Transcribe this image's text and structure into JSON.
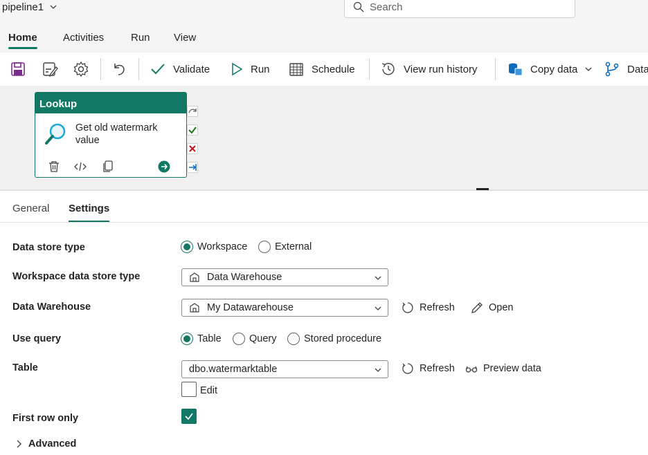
{
  "header": {
    "pipeline_name": "pipeline1",
    "search_placeholder": "Search"
  },
  "menu_tabs": [
    {
      "label": "Home",
      "active": true
    },
    {
      "label": "Activities",
      "active": false
    },
    {
      "label": "Run",
      "active": false
    },
    {
      "label": "View",
      "active": false
    }
  ],
  "toolbar": {
    "validate": "Validate",
    "run": "Run",
    "schedule": "Schedule",
    "view_run_history": "View run history",
    "copy_data": "Copy data",
    "dataflow": "Data"
  },
  "activity": {
    "type": "Lookup",
    "name": "Get old watermark value"
  },
  "panel_tabs": [
    {
      "label": "General",
      "active": false
    },
    {
      "label": "Settings",
      "active": true
    }
  ],
  "settings": {
    "data_store_type": {
      "label": "Data store type",
      "options": [
        "Workspace",
        "External"
      ],
      "selected": "Workspace"
    },
    "workspace_store_type": {
      "label": "Workspace data store type",
      "value": "Data Warehouse"
    },
    "data_warehouse": {
      "label": "Data Warehouse",
      "value": "My Datawarehouse",
      "refresh": "Refresh",
      "open": "Open"
    },
    "use_query": {
      "label": "Use query",
      "options": [
        "Table",
        "Query",
        "Stored procedure"
      ],
      "selected": "Table"
    },
    "table": {
      "label": "Table",
      "value": "dbo.watermarktable",
      "refresh": "Refresh",
      "preview": "Preview data",
      "edit": "Edit",
      "edit_checked": false
    },
    "first_row_only": {
      "label": "First row only",
      "checked": true
    },
    "advanced": "Advanced"
  },
  "colors": {
    "accent": "#117865",
    "save_icon": "#7b2d8e",
    "copy_data_icon": "#0f6cbd"
  }
}
